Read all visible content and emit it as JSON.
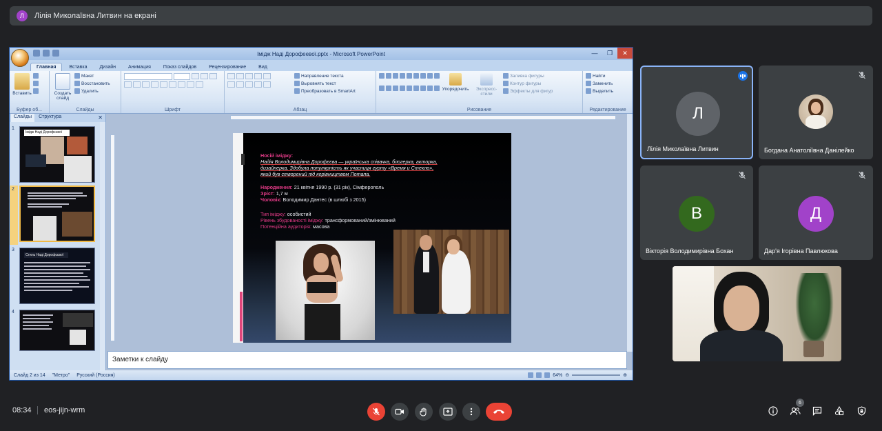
{
  "presenting": {
    "avatar_letter": "Л",
    "text": "Лілія Миколаївна Литвин на екрані"
  },
  "ppt": {
    "window_title": "Імідж Наді Дорофеевої.pptx - Microsoft PowerPoint",
    "tabs": [
      "Главная",
      "Вставка",
      "Дизайн",
      "Анимация",
      "Показ слайдов",
      "Рецензирование",
      "Вид"
    ],
    "ribbon": {
      "paste": "Вставить",
      "create_slide": "Создать слайд",
      "layout": "Макет",
      "reset": "Восстановить",
      "delete": "Удалить",
      "text_direction": "Направление текста",
      "align_text": "Выровнять текст",
      "to_smartart": "Преобразовать в SmartArt",
      "arrange": "Упорядочить",
      "quick_styles": "Экспресс-стили",
      "shape_fill": "Заливка фигуры",
      "shape_outline": "Контур фигуры",
      "shape_effects": "Эффекты для фигур",
      "find": "Найти",
      "replace": "Заменить",
      "select": "Выделить",
      "groups": [
        "Буфер об...",
        "Слайды",
        "Шрифт",
        "Абзац",
        "Рисование",
        "Редактирование"
      ]
    },
    "pane_tabs": [
      "Слайды",
      "Структура"
    ],
    "thumb_numbers": [
      "1",
      "2",
      "3",
      "4"
    ],
    "thumb1_title": "Імідж Наді Дорофєєвої",
    "thumb3_title": "Стиль Наді Дорофєєвої",
    "slide": {
      "carrier_label": "Носій іміджу:",
      "carrier_line1": "Надія Володимирівна Дорофєєва — українська співачка, блогерка, акторка,",
      "carrier_line2": "дизайнерка. Здобула популярність як учасниця гурту «Время и Стекло»,",
      "carrier_line3": "який був створений під керівництвом Потапа.",
      "birth_label": "Народження:",
      "birth_value": " 21 квітня 1990 р. (31 рік), Сімферополь",
      "height_label": "Зріст:",
      "height_value": " 1,7 м",
      "husband_label": "Чоловік:",
      "husband_value": " Володимир Дантес (в шлюбі з 2015)",
      "type_label": "Тип іміджу:",
      "type_value": " особистий",
      "level_label": "Рівень збудованості іміджу:",
      "level_value": " трансформований/змінюваний",
      "audience_label": "Потенційна аудиторія:",
      "audience_value": " масова"
    },
    "notes_placeholder": "Заметки к слайду",
    "status": {
      "slide_of": "Слайд 2 из 14",
      "theme": "\"Метро\"",
      "language": "Русский (Россия)",
      "zoom": "64%"
    }
  },
  "participants": [
    {
      "name": "Лілія Миколаївна Литвин",
      "letter": "Л",
      "color": "#a142c9",
      "speaking": true
    },
    {
      "name": "Богдана Анатоліївна Данілейко",
      "letter": "",
      "color": "",
      "speaking": false
    },
    {
      "name": "Вікторія Володимирівна Бохан",
      "letter": "В",
      "color": "#33691e",
      "speaking": false
    },
    {
      "name": "Дар'я Ігорівна Павлюкова",
      "letter": "Д",
      "color": "#a142c9",
      "speaking": false
    }
  ],
  "bottom": {
    "time": "08:34",
    "meeting_code": "eos-jijn-wrm",
    "participants_count": "6"
  }
}
